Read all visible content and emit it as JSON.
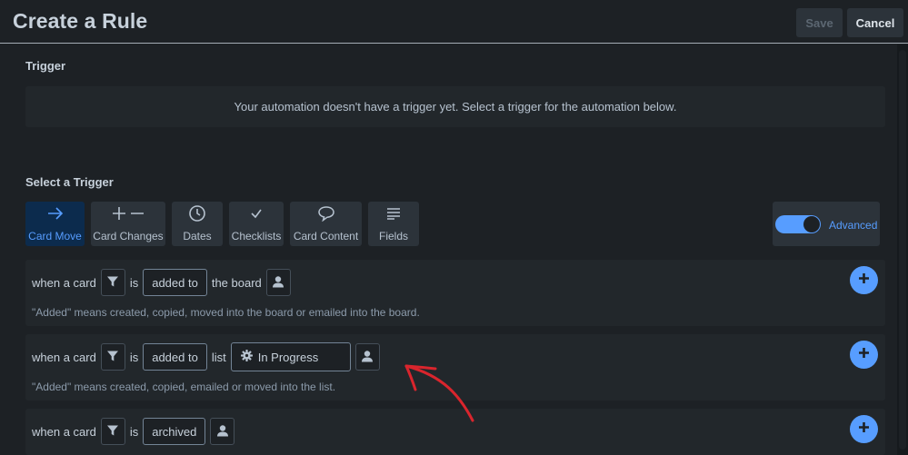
{
  "header": {
    "title": "Create a Rule",
    "save_label": "Save",
    "cancel_label": "Cancel"
  },
  "trigger": {
    "heading": "Trigger",
    "empty_message": "Your automation doesn't have a trigger yet. Select a trigger for the automation below."
  },
  "select_trigger": {
    "heading": "Select a Trigger",
    "tabs": [
      {
        "label": "Card Move",
        "icon": "arrow-right-icon",
        "active": true
      },
      {
        "label": "Card Changes",
        "icon": "plus-minus-icon",
        "active": false
      },
      {
        "label": "Dates",
        "icon": "clock-icon",
        "active": false
      },
      {
        "label": "Checklists",
        "icon": "checkmark-icon",
        "active": false
      },
      {
        "label": "Card Content",
        "icon": "speech-bubble-icon",
        "active": false
      },
      {
        "label": "Fields",
        "icon": "lines-icon",
        "active": false
      }
    ],
    "advanced_label": "Advanced",
    "advanced_enabled": true
  },
  "rules": [
    {
      "prefix": "when a card",
      "is": "is",
      "action": "added to",
      "target": "the board",
      "description": "\"Added\" means created, copied, moved into the board or emailed into the board."
    },
    {
      "prefix": "when a card",
      "is": "is",
      "action": "added to",
      "target": "list",
      "list_value": "In Progress",
      "description": "\"Added\" means created, copied, emailed or moved into the list."
    },
    {
      "prefix": "when a card",
      "is": "is",
      "action": "archived"
    }
  ],
  "colors": {
    "accent": "#579dff",
    "background": "#1d2125",
    "card": "#22272b",
    "annotation": "#d9252d"
  }
}
